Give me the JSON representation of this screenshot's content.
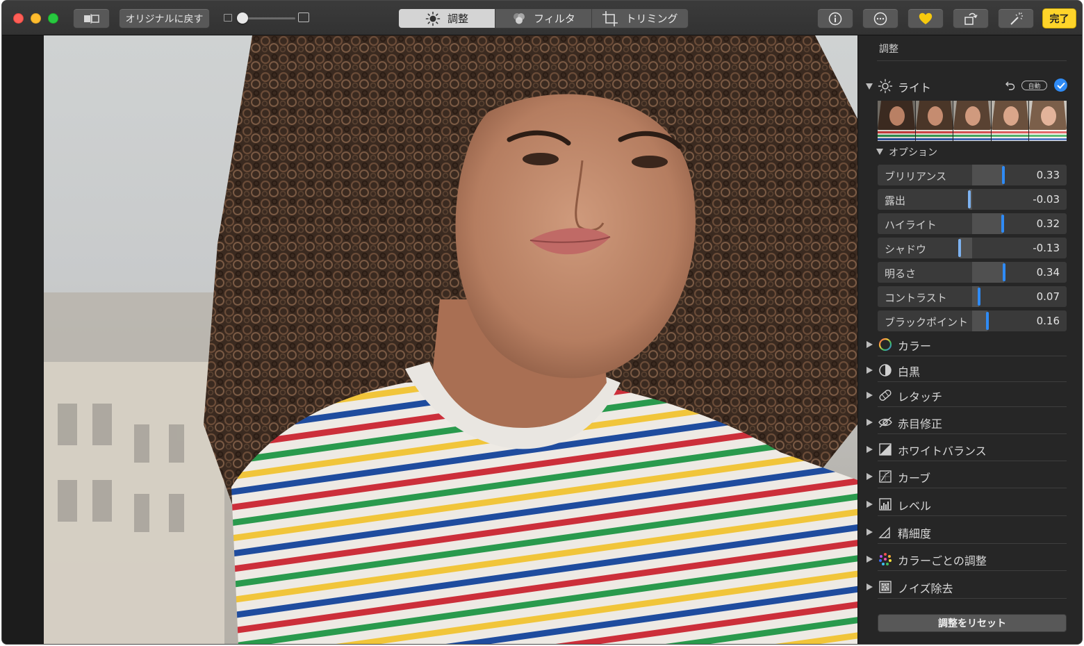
{
  "toolbar": {
    "revert_label": "オリジナルに戻す",
    "tabs": [
      {
        "label": "調整",
        "icon": "sun-icon",
        "active": true
      },
      {
        "label": "フィルタ",
        "icon": "filter-icon",
        "active": false
      },
      {
        "label": "トリミング",
        "icon": "crop-icon",
        "active": false
      }
    ],
    "done_label": "完了",
    "icons": [
      "info-icon",
      "more-icon",
      "heart-icon",
      "rotate-icon",
      "magic-wand-icon"
    ],
    "accent_done": "#fed42a"
  },
  "sidebar": {
    "title": "調整",
    "light": {
      "label": "ライト",
      "auto_label": "自動",
      "options_label": "オプション",
      "sliders": [
        {
          "label": "ブリリアンス",
          "value": "0.33",
          "num": 0.33
        },
        {
          "label": "露出",
          "value": "-0.03",
          "num": -0.03
        },
        {
          "label": "ハイライト",
          "value": "0.32",
          "num": 0.32
        },
        {
          "label": "シャドウ",
          "value": "-0.13",
          "num": -0.13
        },
        {
          "label": "明るさ",
          "value": "0.34",
          "num": 0.34
        },
        {
          "label": "コントラスト",
          "value": "0.07",
          "num": 0.07
        },
        {
          "label": "ブラックポイント",
          "value": "0.16",
          "num": 0.16
        }
      ]
    },
    "sections": [
      {
        "label": "カラー",
        "icon": "color-wheel-icon"
      },
      {
        "label": "白黒",
        "icon": "black-white-icon"
      },
      {
        "label": "レタッチ",
        "icon": "bandage-icon"
      },
      {
        "label": "赤目修正",
        "icon": "red-eye-icon"
      },
      {
        "label": "ホワイトバランス",
        "icon": "white-balance-icon"
      },
      {
        "label": "カーブ",
        "icon": "curves-icon"
      },
      {
        "label": "レベル",
        "icon": "levels-icon"
      },
      {
        "label": "精細度",
        "icon": "definition-icon"
      },
      {
        "label": "カラーごとの調整",
        "icon": "selective-color-icon"
      },
      {
        "label": "ノイズ除去",
        "icon": "noise-reduction-icon"
      }
    ],
    "reset_label": "調整をリセット",
    "accent_blue": "#2f8bf5"
  }
}
